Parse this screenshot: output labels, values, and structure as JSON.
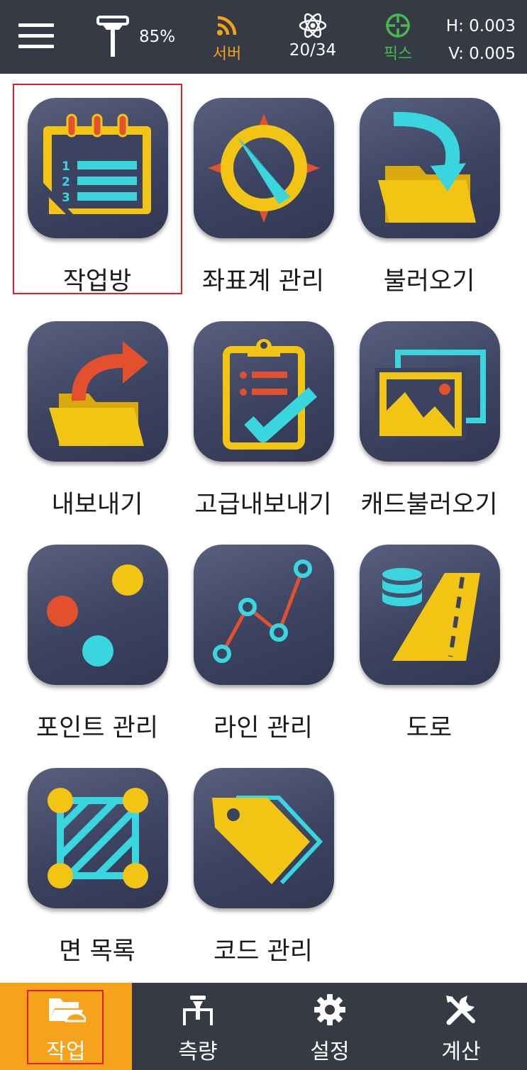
{
  "status_bar": {
    "battery_percent": "85%",
    "server_label": "서버",
    "satellites": "20/34",
    "fix_label": "픽스",
    "h_precision": "H: 0.003",
    "v_precision": "V: 0.005",
    "colors": {
      "bar_bg": "#353a44",
      "server": "#f5a21b",
      "fix": "#47b84e"
    }
  },
  "menu": {
    "items": [
      {
        "label": "작업방",
        "icon": "job-notebook-icon",
        "selected": true
      },
      {
        "label": "좌표계 관리",
        "icon": "compass-icon"
      },
      {
        "label": "불러오기",
        "icon": "import-folder-icon"
      },
      {
        "label": "내보내기",
        "icon": "export-folder-icon"
      },
      {
        "label": "고급내보내기",
        "icon": "clipboard-check-icon"
      },
      {
        "label": "캐드불러오기",
        "icon": "image-stack-icon"
      },
      {
        "label": "포인트 관리",
        "icon": "points-icon"
      },
      {
        "label": "라인 관리",
        "icon": "polyline-icon"
      },
      {
        "label": "도로",
        "icon": "road-database-icon"
      },
      {
        "label": "면 목록",
        "icon": "hatched-area-icon"
      },
      {
        "label": "코드 관리",
        "icon": "tag-icon"
      }
    ],
    "colors": {
      "tile": "#3c4360",
      "yellow": "#f2c413",
      "cyan": "#3ad6df",
      "red": "#e2502e"
    }
  },
  "bottom_nav": {
    "items": [
      {
        "label": "작업",
        "icon": "folder-icon",
        "active": true
      },
      {
        "label": "측량",
        "icon": "survey-instrument-icon"
      },
      {
        "label": "설정",
        "icon": "gear-icon"
      },
      {
        "label": "계산",
        "icon": "tools-icon"
      }
    ],
    "colors": {
      "active_bg": "#f7a21b",
      "bg": "#353a44"
    }
  }
}
